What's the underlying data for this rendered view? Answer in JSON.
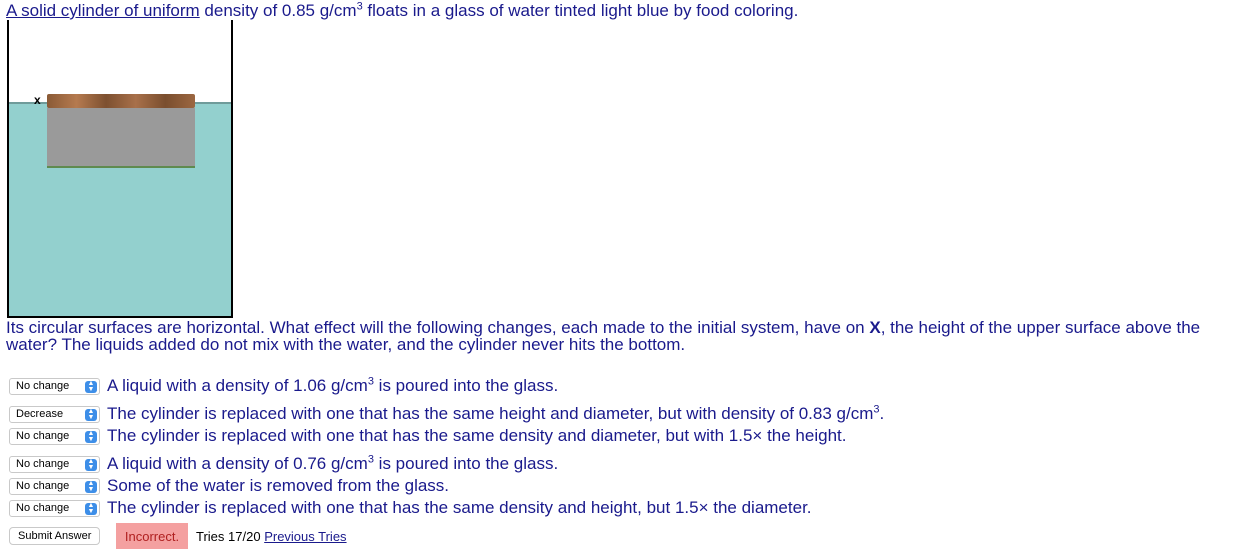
{
  "question": {
    "title_part1": "A solid cylinder of uniform",
    "title_part2": " density of 0.85 g/cm",
    "title_sup": "3",
    "title_part3": " floats in a glass of water tinted light blue by food coloring.",
    "figure_marker": "x",
    "description_part1": "Its circular surfaces are horizontal. What effect will the following changes, each made to the initial system, have on ",
    "description_bold": "X",
    "description_part2": ", the height of the upper surface above the water? The liquids added do not mix with the water, and the cylinder never hits the bottom."
  },
  "items": [
    {
      "selected": "No change",
      "text_a": "A liquid with a density of 1.06 g/cm",
      "sup": "3",
      "text_b": " is poured into the glass."
    },
    {
      "selected": "Decrease",
      "text_a": "The cylinder is replaced with one that has the same height and diameter, but with density of 0.83 g/cm",
      "sup": "3",
      "text_b": "."
    },
    {
      "selected": "No change",
      "text_a": "The cylinder is replaced with one that has the same density and diameter, but with 1.5× the height.",
      "sup": "",
      "text_b": ""
    },
    {
      "selected": "No change",
      "text_a": "A liquid with a density of 0.76 g/cm",
      "sup": "3",
      "text_b": " is poured into the glass."
    },
    {
      "selected": "No change",
      "text_a": "Some of the water is removed from the glass.",
      "sup": "",
      "text_b": ""
    },
    {
      "selected": "No change",
      "text_a": "The cylinder is replaced with one that has the same density and height, but 1.5× the diameter.",
      "sup": "",
      "text_b": ""
    }
  ],
  "footer": {
    "submit_label": "Submit Answer",
    "status": "Incorrect.",
    "tries_text": "Tries 17/20",
    "previous_tries_link": "Previous Tries"
  },
  "colors": {
    "water": "#93d0ce",
    "incorrect_bg": "#f4a0a0",
    "text": "#1a1a8c"
  }
}
